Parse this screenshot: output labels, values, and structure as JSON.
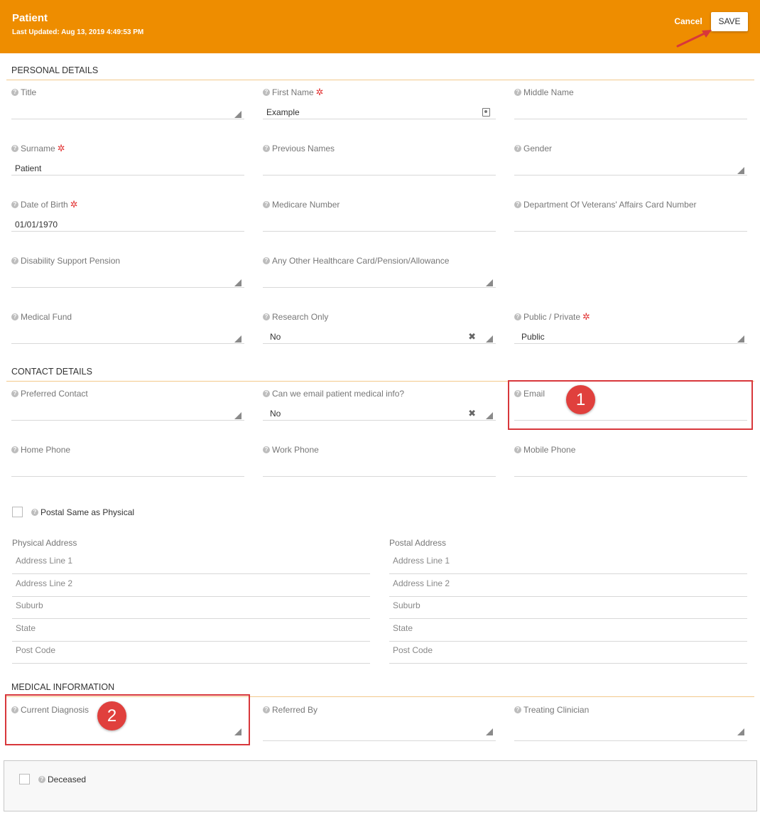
{
  "header": {
    "title": "Patient",
    "last_updated": "Last Updated: Aug 13, 2019 4:49:53 PM",
    "cancel_label": "Cancel",
    "save_label": "SAVE",
    "bg_color": "#ee8d00"
  },
  "personal": {
    "section_title": "PERSONAL DETAILS",
    "title": {
      "label": "Title",
      "value": ""
    },
    "first_name": {
      "label": "First Name",
      "value": "Example"
    },
    "middle_name": {
      "label": "Middle Name",
      "value": ""
    },
    "surname": {
      "label": "Surname",
      "value": "Patient"
    },
    "previous_names": {
      "label": "Previous Names",
      "value": ""
    },
    "gender": {
      "label": "Gender",
      "value": ""
    },
    "dob": {
      "label": "Date of Birth",
      "value": "01/01/1970"
    },
    "medicare": {
      "label": "Medicare Number",
      "value": ""
    },
    "dva": {
      "label": "Department Of Veterans' Affairs Card Number",
      "value": ""
    },
    "disability": {
      "label": "Disability Support Pension",
      "value": ""
    },
    "healthcare_card": {
      "label": "Any Other Healthcare Card/Pension/Allowance",
      "value": ""
    },
    "medical_fund": {
      "label": "Medical Fund",
      "value": ""
    },
    "research_only": {
      "label": "Research Only",
      "value": "No"
    },
    "public_private": {
      "label": "Public / Private",
      "value": "Public"
    }
  },
  "contact": {
    "section_title": "CONTACT DETAILS",
    "preferred_contact": {
      "label": "Preferred Contact",
      "value": ""
    },
    "email_medical": {
      "label": "Can we email patient medical info?",
      "value": "No"
    },
    "email": {
      "label": "Email",
      "value": ""
    },
    "home_phone": {
      "label": "Home Phone",
      "value": ""
    },
    "work_phone": {
      "label": "Work Phone",
      "value": ""
    },
    "mobile_phone": {
      "label": "Mobile Phone",
      "value": ""
    },
    "postal_same": "Postal Same as Physical",
    "physical_label": "Physical Address",
    "postal_label": "Postal Address",
    "address_placeholders": [
      "Address Line 1",
      "Address Line 2",
      "Suburb",
      "State",
      "Post Code"
    ]
  },
  "medical": {
    "section_title": "MEDICAL INFORMATION",
    "current_diagnosis": {
      "label": "Current Diagnosis",
      "value": ""
    },
    "referred_by": {
      "label": "Referred By",
      "value": ""
    },
    "treating_clinician": {
      "label": "Treating Clinician",
      "value": ""
    }
  },
  "deceased_label": "Deceased",
  "callouts": {
    "one": "1",
    "two": "2",
    "color": "#d8373b"
  },
  "icons": {
    "help": "help-circle-icon",
    "required": "required-asterisk-icon",
    "dropdown": "dropdown-triangle-icon",
    "clear": "clear-x-icon",
    "contact_card": "contact-card-icon",
    "pointer_arrow": "pointer-arrow-icon"
  }
}
